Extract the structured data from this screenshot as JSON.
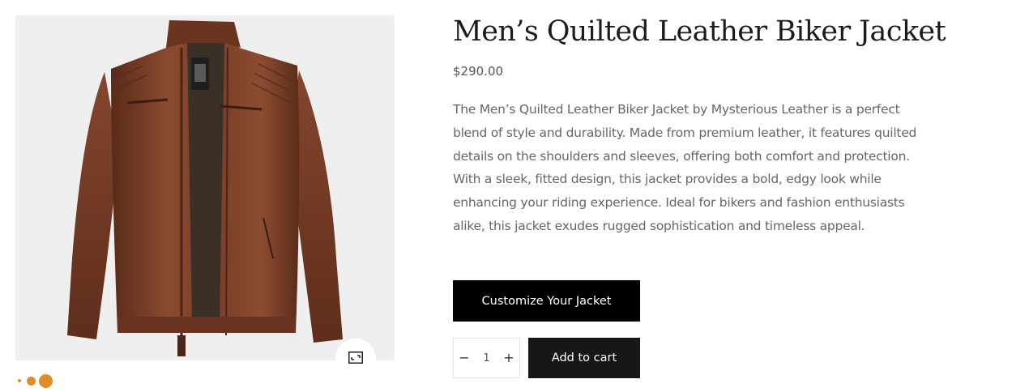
{
  "product": {
    "title": "Men’s Quilted Leather Biker Jacket",
    "price": "$290.00",
    "description": "The Men’s Quilted Leather Biker Jacket by Mysterious Leather is a perfect blend of style and durability. Made from premium leather, it features quilted details on the shoulders and sleeves, offering both comfort and protection. With a sleek, fitted design, this jacket provides a bold, edgy look while enhancing your riding experience. Ideal for bikers and fashion enthusiasts alike, this jacket exudes rugged sophistication and timeless appeal."
  },
  "actions": {
    "customize_label": "Customize Your Jacket",
    "add_to_cart_label": "Add to cart",
    "quantity": "1",
    "minus_symbol": "−",
    "plus_symbol": "+"
  },
  "gallery": {
    "image_icon": "brown-leather-jacket-photo",
    "zoom_icon": "expand-icon",
    "dot_count": 3,
    "active_dot": 3
  },
  "colors": {
    "accent": "#df8d25",
    "leather": "#7a3d27",
    "button_dark": "#000000",
    "image_bg": "#efefef"
  }
}
